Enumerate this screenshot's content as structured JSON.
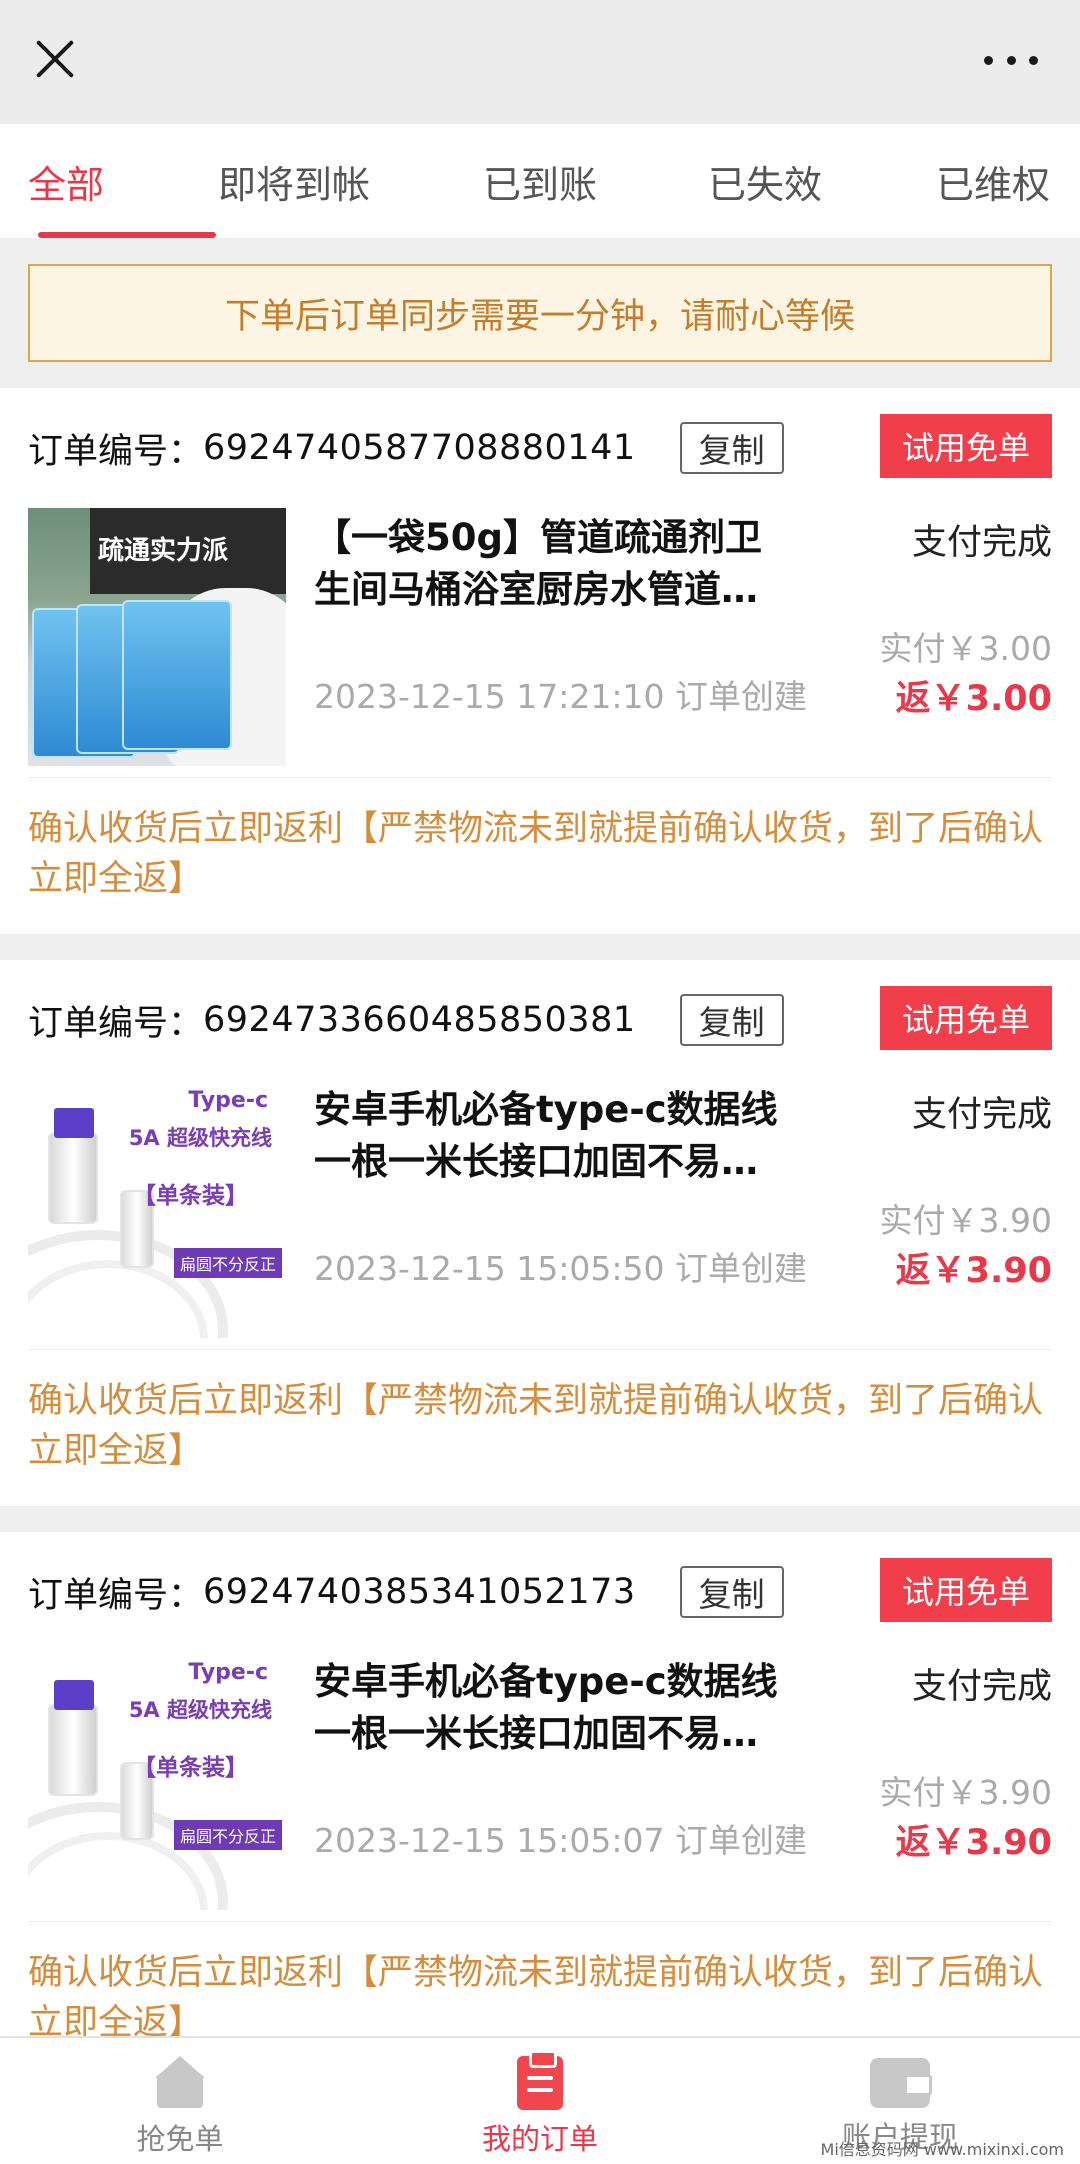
{
  "topbar": {
    "close_icon": "close-icon",
    "more_icon": "more-icon"
  },
  "tabs": [
    {
      "label": "全部",
      "active": true
    },
    {
      "label": "即将到帐",
      "active": false
    },
    {
      "label": "已到账",
      "active": false
    },
    {
      "label": "已失效",
      "active": false
    },
    {
      "label": "已维权",
      "active": false
    }
  ],
  "notice": "下单后订单同步需要一分钟，请耐心等候",
  "orders": [
    {
      "order_no_label": "订单编号：",
      "order_no": "6924740587708880141",
      "copy_label": "复制",
      "tag": "试用免单",
      "product_image": "pipe-cleaner",
      "image_text": "疏通实力派",
      "title": "【一袋50g】管道疏通剂卫生间马桶浴室厨房水管道…",
      "created": "2023-12-15 17:21:10 订单创建",
      "status": "支付完成",
      "paid": "实付￥3.00",
      "rebate": "返￥3.00",
      "remark": "确认收货后立即返利【严禁物流未到就提前确认收货，到了后确认立即全返】"
    },
    {
      "order_no_label": "订单编号：",
      "order_no": "6924733660485850381",
      "copy_label": "复制",
      "tag": "试用免单",
      "product_image": "type-c-cable",
      "image_text": [
        "Type-c",
        "5A 超级快充线",
        "【单条装】",
        "扁圆不分反正"
      ],
      "title": "安卓手机必备type-c数据线一根一米长接口加固不易…",
      "created": "2023-12-15 15:05:50 订单创建",
      "status": "支付完成",
      "paid": "实付￥3.90",
      "rebate": "返￥3.90",
      "remark": "确认收货后立即返利【严禁物流未到就提前确认收货，到了后确认立即全返】"
    },
    {
      "order_no_label": "订单编号：",
      "order_no": "6924740385341052173",
      "copy_label": "复制",
      "tag": "试用免单",
      "product_image": "type-c-cable",
      "image_text": [
        "Type-c",
        "5A 超级快充线",
        "【单条装】",
        "扁圆不分反正"
      ],
      "title": "安卓手机必备type-c数据线一根一米长接口加固不易…",
      "created": "2023-12-15 15:05:07 订单创建",
      "status": "支付完成",
      "paid": "实付￥3.90",
      "rebate": "返￥3.90",
      "remark": "确认收货后立即返利【严禁物流未到就提前确认收货，到了后确认立即全返】"
    }
  ],
  "bottom_nav": [
    {
      "label": "抢免单",
      "icon": "home-icon",
      "active": false
    },
    {
      "label": "我的订单",
      "icon": "order-icon",
      "active": true
    },
    {
      "label": "账户提现",
      "icon": "wallet-icon",
      "active": false
    }
  ],
  "watermark": "Mi信息资码网 www.mixinxi.com",
  "colors": {
    "accent": "#e8394a",
    "notice_text": "#c47d2a",
    "remark_text": "#d58d3b",
    "tag_bg": "#f03f4b"
  }
}
